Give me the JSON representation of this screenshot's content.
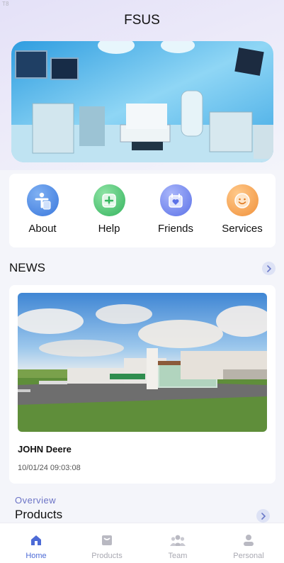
{
  "corner_tag": "T8",
  "app": {
    "title": "FSUS"
  },
  "quick_links": [
    {
      "label": "About",
      "icon": "about-icon"
    },
    {
      "label": "Help",
      "icon": "help-icon"
    },
    {
      "label": "Friends",
      "icon": "friends-icon"
    },
    {
      "label": "Services",
      "icon": "services-icon"
    }
  ],
  "news": {
    "heading": "NEWS",
    "item": {
      "title": "JOHN Deere",
      "date": "10/01/24 09:03:08"
    }
  },
  "products": {
    "overline": "Overview",
    "heading": "Products"
  },
  "tabbar": {
    "active": "Home",
    "tabs": [
      {
        "label": "Home",
        "icon": "home-icon"
      },
      {
        "label": "Products",
        "icon": "products-icon"
      },
      {
        "label": "Team",
        "icon": "team-icon"
      },
      {
        "label": "Personal",
        "icon": "personal-icon"
      }
    ]
  },
  "colors": {
    "accent": "#4d6bd6",
    "overline": "#6b73c6",
    "inactive": "#a9a9b2"
  }
}
